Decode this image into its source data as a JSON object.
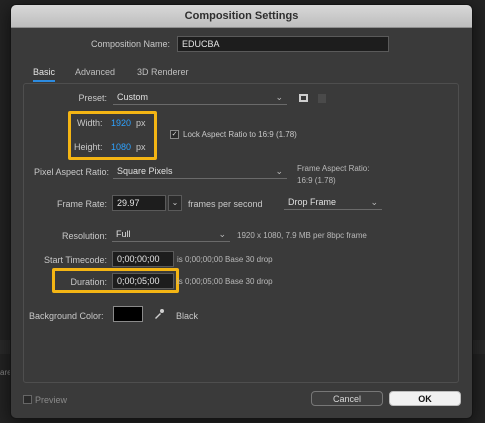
{
  "window": {
    "title": "Composition Settings"
  },
  "comp_name": {
    "label": "Composition Name:",
    "value": "EDUCBA"
  },
  "tabs": [
    {
      "label": "Basic",
      "active": true
    },
    {
      "label": "Advanced",
      "active": false
    },
    {
      "label": "3D Renderer",
      "active": false
    }
  ],
  "preset": {
    "label": "Preset:",
    "value": "Custom"
  },
  "width": {
    "label": "Width:",
    "value": "1920",
    "unit": "px"
  },
  "height": {
    "label": "Height:",
    "value": "1080",
    "unit": "px"
  },
  "lock_aspect": {
    "label": "Lock Aspect Ratio to 16:9 (1.78)",
    "checked": true
  },
  "pixel_aspect": {
    "label": "Pixel Aspect Ratio:",
    "value": "Square Pixels",
    "frame_aspect_label": "Frame Aspect Ratio:",
    "frame_aspect_value": "16:9 (1.78)"
  },
  "frame_rate": {
    "label": "Frame Rate:",
    "value": "29.97",
    "unit": "frames per second",
    "drop_value": "Drop Frame"
  },
  "resolution": {
    "label": "Resolution:",
    "value": "Full",
    "info": "1920 x 1080, 7.9 MB per 8bpc frame"
  },
  "start_timecode": {
    "label": "Start Timecode:",
    "value": "0;00;00;00",
    "info": "is 0;00;00;00  Base 30  drop"
  },
  "duration": {
    "label": "Duration:",
    "value": "0;00;05;00",
    "info": "is 0;00;05;00  Base 30  drop"
  },
  "background": {
    "label": "Background Color:",
    "color_name": "Black",
    "color": "#000000"
  },
  "preview": {
    "label": "Preview",
    "checked": false
  },
  "buttons": {
    "cancel": "Cancel",
    "ok": "OK"
  },
  "backdrop": {
    "fragment": "are"
  },
  "colors": {
    "accent": "#2ea2ff",
    "highlight": "#f4b514",
    "dialog_bg": "#3a3a3a"
  }
}
